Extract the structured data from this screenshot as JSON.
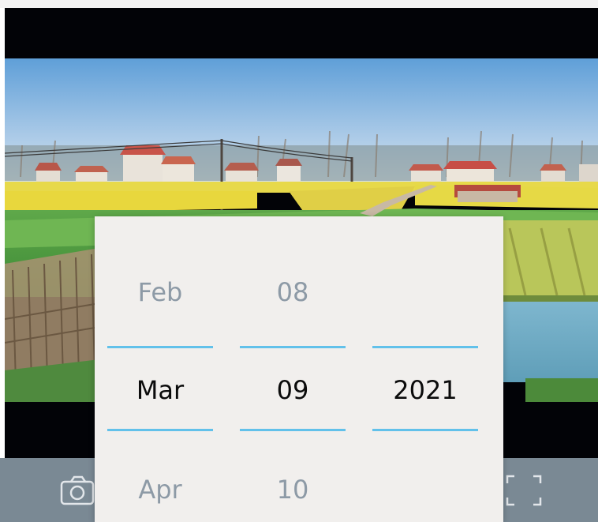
{
  "picker": {
    "month": {
      "prev": "Feb",
      "current": "Mar",
      "next": "Apr"
    },
    "day": {
      "prev": "08",
      "current": "09",
      "next": "10"
    },
    "year": {
      "prev": "",
      "current": "2021",
      "next": ""
    }
  },
  "controls": {
    "left_icon": "camera-icon",
    "right_icon": "fullscreen-icon"
  },
  "colors": {
    "divider": "#62c1ea",
    "selected_text": "#0b0b0b",
    "dim_text": "#8d9aa6",
    "picker_bg": "#f1efed",
    "controls_bg": "#7a8994"
  }
}
